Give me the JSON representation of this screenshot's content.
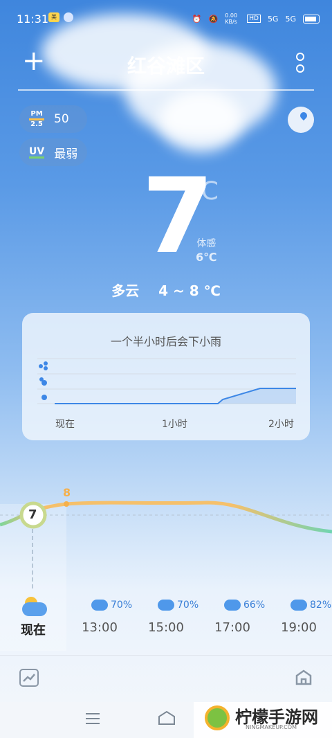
{
  "status_bar": {
    "time": "11:31",
    "net_speed": "0.00 KB/s",
    "hd": "HD",
    "sim1": "5G",
    "sim2": "5G"
  },
  "header": {
    "city": "红谷滩区"
  },
  "air": {
    "pm_label_top": "PM",
    "pm_label_bottom": "2.5",
    "pm_value": "50",
    "uv_label": "UV",
    "uv_value": "最弱"
  },
  "current": {
    "temp": "7",
    "unit": "℃",
    "feels_label": "体感",
    "feels_value": "6℃",
    "condition": "多云",
    "range": "4 ~ 8 ℃"
  },
  "rain_card": {
    "title": "一个半小时后会下小雨",
    "axis": [
      "现在",
      "1小时",
      "2小时"
    ]
  },
  "hourly": {
    "peak_label": "8",
    "now_temp": "7",
    "items": [
      {
        "time": "现在",
        "pct": "",
        "icon": "partly-cloudy-icon"
      },
      {
        "time": "13:00",
        "pct": "70%",
        "icon": "rain-cloud-icon"
      },
      {
        "time": "15:00",
        "pct": "70%",
        "icon": "rain-cloud-icon"
      },
      {
        "time": "17:00",
        "pct": "66%",
        "icon": "rain-cloud-icon"
      },
      {
        "time": "19:00",
        "pct": "82%",
        "icon": "rain-cloud-icon"
      }
    ]
  },
  "watermark": {
    "text": "柠檬手游网",
    "sub": "NINGMAKEUP.COM"
  }
}
